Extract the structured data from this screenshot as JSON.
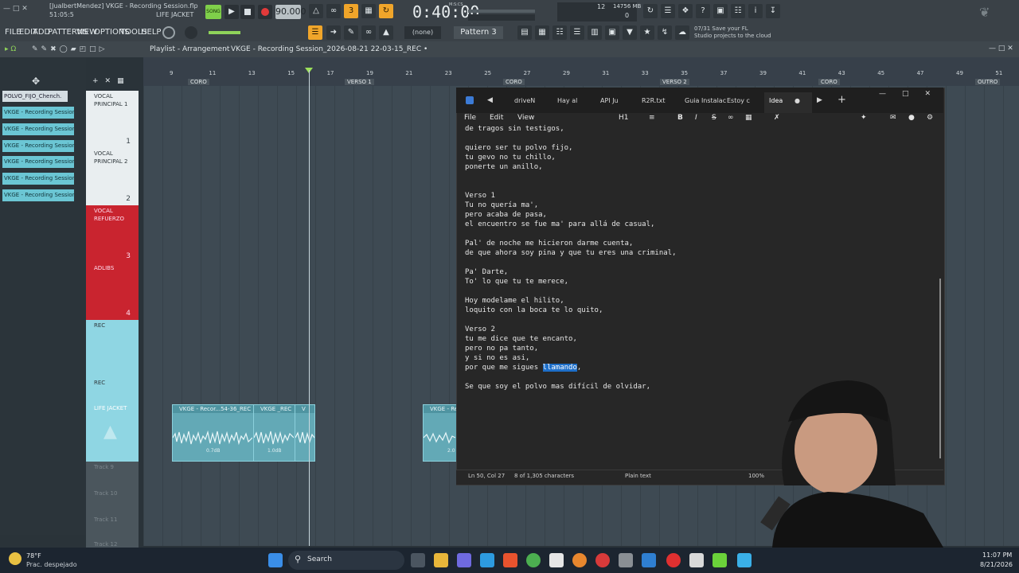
{
  "fl": {
    "title_line1": "[JualbertMendez] VKGE - Recording Session.flp",
    "title_line2": "51:05:5",
    "title_line3": "LIFE JACKET",
    "song_label": "SONG",
    "tempo": "90.000",
    "time": "0:40:00",
    "time_label": "M:S:CS",
    "cpu_a": "12",
    "cpu_b": "14756 MB",
    "cpu_c": "0",
    "menu": [
      "FILE",
      "EDIT",
      "ADD",
      "PATTERNS",
      "VIEW",
      "OPTIONS",
      "TOOLS",
      "HELP"
    ],
    "pattern_select": "(none)",
    "pattern": "Pattern 3",
    "hint_line1": "07/31  Save your FL",
    "hint_line2": "Studio projects to the cloud"
  },
  "playlist": {
    "title": "Playlist - Arrangement",
    "session": "VKGE - Recording Session_2026-08-21 22-03-15_REC •",
    "ruler_numbers": [
      "9",
      "11",
      "13",
      "15",
      "17",
      "19",
      "21",
      "23",
      "25",
      "27",
      "29",
      "31",
      "33",
      "35",
      "37",
      "39",
      "41",
      "43",
      "45",
      "47",
      "49",
      "51"
    ],
    "markers": [
      "CORO",
      "VERSO 1",
      "CORO",
      "VERSO 2",
      "CORO",
      "OUTRO"
    ],
    "browser_head": "POLVO_FIJO_Chench.",
    "browser_items": [
      "VKGE - Recording Session",
      "VKGE - Recording Session",
      "VKGE - Recording Session",
      "VKGE - Recording Session",
      "VKGE - Recording Session",
      "VKGE - Recording Session"
    ],
    "tracks": [
      {
        "name": "VOCAL PRINCIPAL 1",
        "num": "1"
      },
      {
        "name": "VOCAL PRINCIPAL 2",
        "num": "2"
      },
      {
        "name": "VOCAL REFUERZO",
        "num": "3"
      },
      {
        "name": "ADLIBS",
        "num": "4"
      },
      {
        "name": "REC",
        "num": ""
      },
      {
        "name": "REC",
        "num": ""
      },
      {
        "name": "LIFE JACKET",
        "num": ""
      },
      {
        "name": "Track 9",
        "num": ""
      },
      {
        "name": "Track 10",
        "num": ""
      },
      {
        "name": "Track 11",
        "num": ""
      },
      {
        "name": "Track 12",
        "num": ""
      }
    ],
    "clips": [
      {
        "title": "VKGE - Recor...54-36_REC",
        "level": "0.7dB"
      },
      {
        "title": "VKGE _REC",
        "level": "1.0dB"
      },
      {
        "title": "V",
        "level": ""
      },
      {
        "title": "VKGE - Re",
        "level": "2.0"
      }
    ]
  },
  "notepad": {
    "tabs": [
      "driveN",
      "Hay al",
      "API Ju",
      "R2R.txt",
      "Guia Instalac",
      "Estoy c",
      "Idea"
    ],
    "menu": [
      "File",
      "Edit",
      "View"
    ],
    "heading": "H1",
    "lines": [
      "de tragos sin testigos,",
      "",
      "quiero ser tu polvo fijo,",
      "tu gevo no tu chillo,",
      "ponerte un anillo,",
      "",
      "",
      "Verso 1",
      "Tu no quería ma',",
      "pero acaba de pasa,",
      "el encuentro se fue ma' para allá de casual,",
      "",
      "Pal' de noche me hicieron darme cuenta,",
      "de que ahora soy pina y que tu eres una criminal,",
      "",
      "Pa' Darte,",
      "To' lo que tu te merece,",
      "",
      "Hoy modelame el hilito,",
      "loquito con la boca te lo quito,",
      "",
      "Verso 2",
      "tu me dice que te encanto,",
      "pero no pa tanto,",
      "y si no es asi,"
    ],
    "line_pre": "por que me sigues ",
    "line_highlight": "llamando",
    "line_post": ",",
    "line_last_blank": "",
    "line_last": "Se que soy el polvo mas difícil de olvidar,",
    "status_pos": "Ln 50, Col 27",
    "status_chars": "8 of 1,305 characters",
    "status_format": "Plain text",
    "status_zoom": "100%"
  },
  "taskbar": {
    "temp": "78°F",
    "weather": "Prac. despejado",
    "search": "Search",
    "time": "11:07 PM",
    "date": "8/21/2026"
  }
}
